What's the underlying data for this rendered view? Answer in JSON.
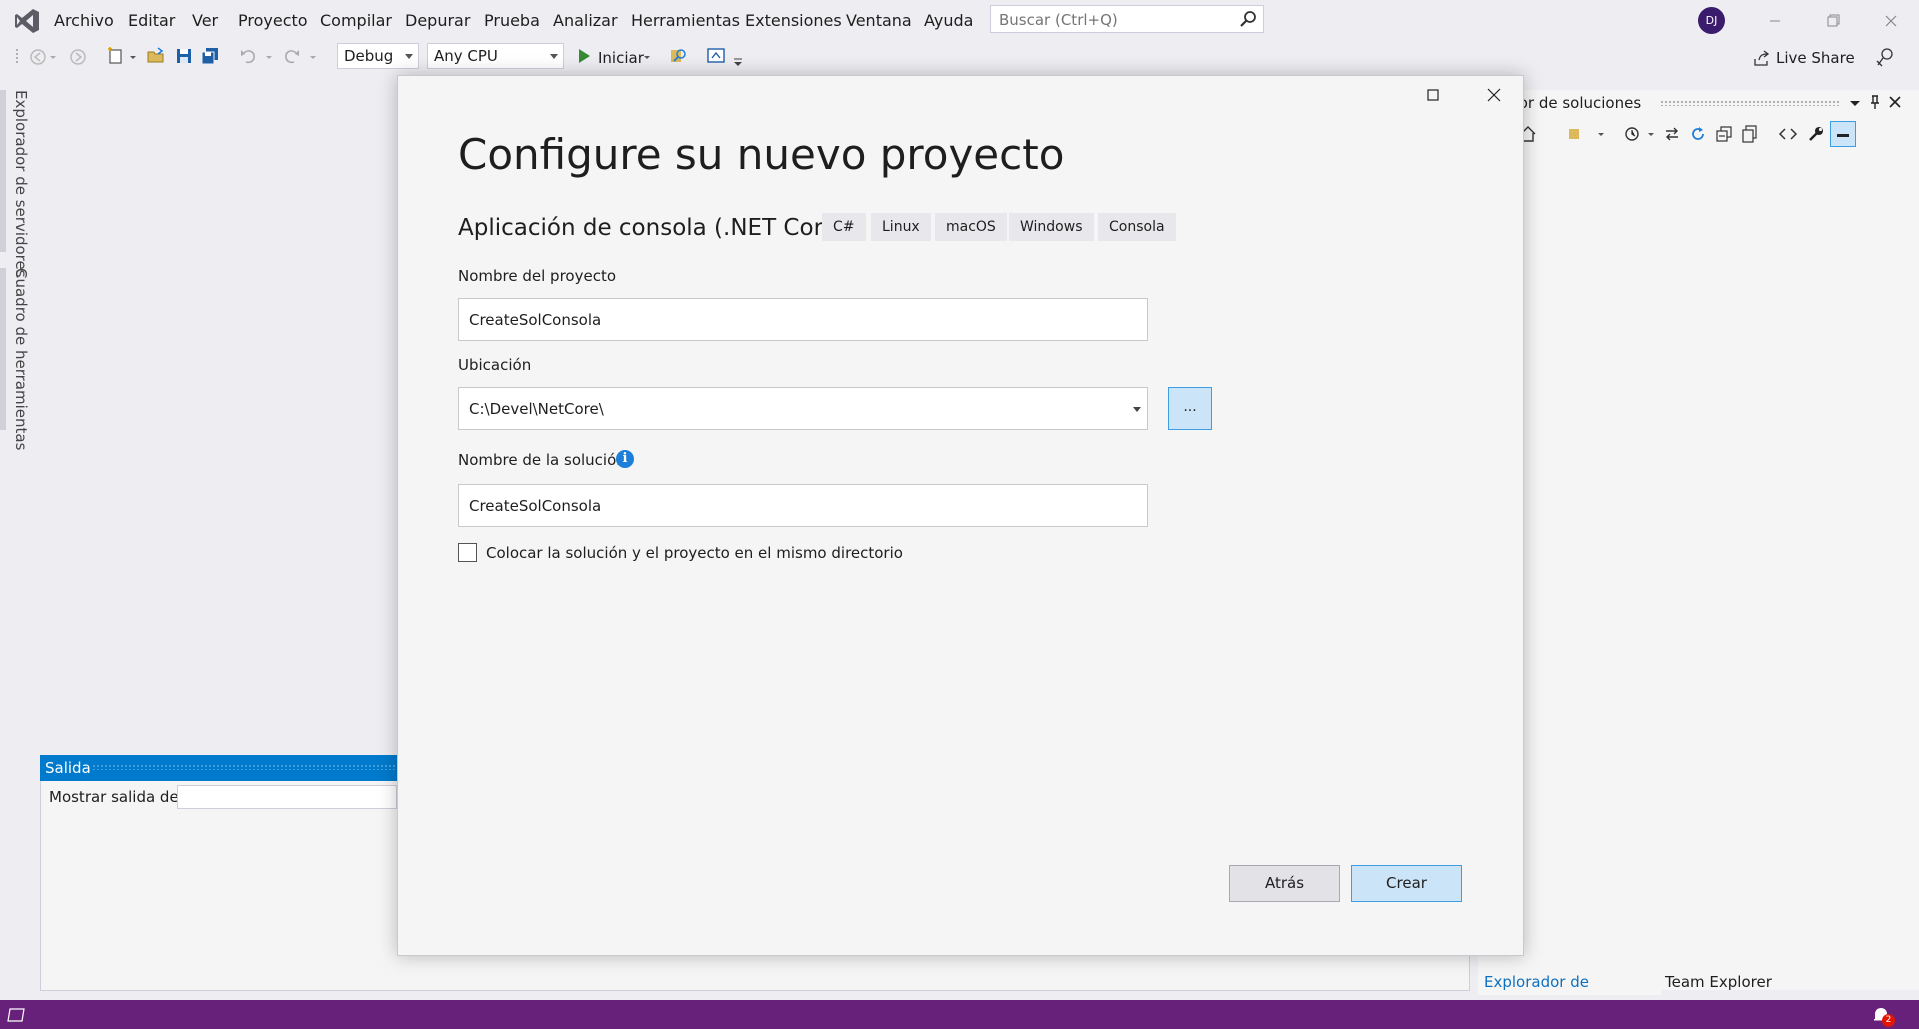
{
  "menu": {
    "items": [
      "Archivo",
      "Editar",
      "Ver",
      "Proyecto",
      "Compilar",
      "Depurar",
      "Prueba",
      "Analizar",
      "Herramientas",
      "Extensiones",
      "Ventana",
      "Ayuda"
    ]
  },
  "search": {
    "placeholder": "Buscar (Ctrl+Q)"
  },
  "user": {
    "initials": "DJ"
  },
  "toolbar": {
    "configuration": "Debug",
    "platform": "Any CPU",
    "start_label": "Iniciar",
    "live_share_label": "Live Share"
  },
  "side_tabs": {
    "server_explorer": "Explorador de servidores",
    "toolbox": "Cuadro de herramientas"
  },
  "output_panel": {
    "title": "Salida",
    "show_output_label": "Mostrar salida de:"
  },
  "solution_explorer": {
    "title": "ador de soluciones",
    "bottom_tabs": [
      "Explorador de soluciones",
      "Team Explorer"
    ]
  },
  "status_bar": {
    "notifications": "2"
  },
  "dialog": {
    "title": "Configure su nuevo proyecto",
    "template_name": "Aplicación de consola (.NET Core)",
    "tags": [
      "C#",
      "Linux",
      "macOS",
      "Windows",
      "Consola"
    ],
    "project_name_label": "Nombre del proyecto",
    "project_name_value": "CreateSolConsola",
    "location_label": "Ubicación",
    "location_value": "C:\\Devel\\NetCore\\",
    "browse_label": "...",
    "solution_name_label": "Nombre de la solución",
    "solution_name_value": "CreateSolConsola",
    "same_dir_label": "Colocar la solución y el proyecto en el mismo directorio",
    "same_dir_checked": false,
    "back_button": "Atrás",
    "create_button": "Crear"
  },
  "colors": {
    "accent": "#007acc",
    "status_bar": "#68217a",
    "button_selected_fill": "#cce4f7",
    "button_selected_border": "#3d9ee3"
  },
  "icons": [
    "visual-studio-logo-icon",
    "search-icon",
    "minimize-icon",
    "restore-icon",
    "close-icon",
    "back-icon",
    "forward-icon",
    "new-project-icon",
    "open-icon",
    "save-icon",
    "save-all-icon",
    "undo-icon",
    "redo-icon",
    "play-icon",
    "find-in-files-icon",
    "live-share-icon",
    "feedback-icon",
    "pin-icon",
    "maximize-icon",
    "info-icon",
    "notification-bell-icon"
  ]
}
